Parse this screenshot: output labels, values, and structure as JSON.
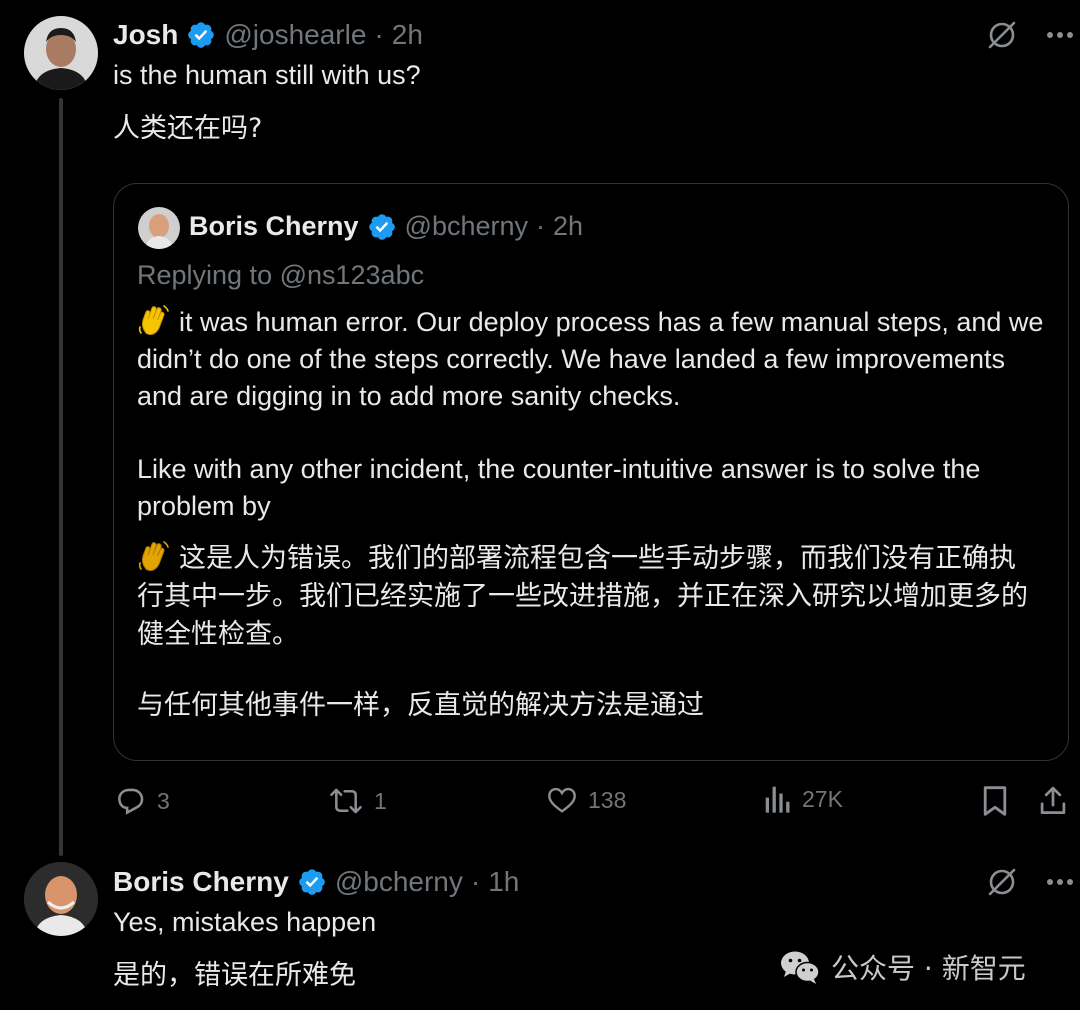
{
  "colors": {
    "background": "#000000",
    "text": "#e7e9ea",
    "muted": "#71767b",
    "verified": "#1d9bf0",
    "border": "#2f3336"
  },
  "tweet1": {
    "author": {
      "name": "Josh",
      "handle": "@joshearle",
      "separator": "·",
      "time": "2h",
      "verified": true
    },
    "text_en": "is the human still with us?",
    "text_cn": "人类还在吗?",
    "icons": [
      "grok-icon",
      "more-icon"
    ]
  },
  "quote": {
    "author": {
      "name": "Boris Cherny",
      "handle": "@bcherny",
      "separator": "·",
      "time": "2h",
      "verified": true
    },
    "replying_to": "Replying to @ns123abc",
    "emoji": "waving-hand-emoji",
    "paragraph1_en": "it was human error. Our deploy process has a few manual steps, and we didn’t do one of the steps correctly. We have landed a few improvements and are digging in to add more sanity checks.",
    "paragraph2_en": "Like with any other incident, the counter-intuitive answer is to solve the problem by",
    "paragraph1_cn": "这是人为错误。我们的部署流程包含一些手动步骤，而我们没有正确执行其中一步。我们已经实施了一些改进措施，并正在深入研究以增加更多的健全性检查。",
    "paragraph2_cn": "与任何其他事件一样，反直觉的解决方法是通过"
  },
  "actions": {
    "replies": "3",
    "reposts": "1",
    "likes": "138",
    "views": "27K",
    "icons": [
      "reply-icon",
      "repost-icon",
      "like-icon",
      "views-icon",
      "bookmark-icon",
      "share-icon"
    ]
  },
  "tweet2": {
    "author": {
      "name": "Boris Cherny",
      "handle": "@bcherny",
      "separator": "·",
      "time": "1h",
      "verified": true
    },
    "text_en": "Yes, mistakes happen",
    "text_cn": "是的，错误在所难免",
    "icons": [
      "grok-icon",
      "more-icon"
    ]
  },
  "watermark": {
    "text": "公众号 · 新智元",
    "icon": "wechat-icon"
  }
}
